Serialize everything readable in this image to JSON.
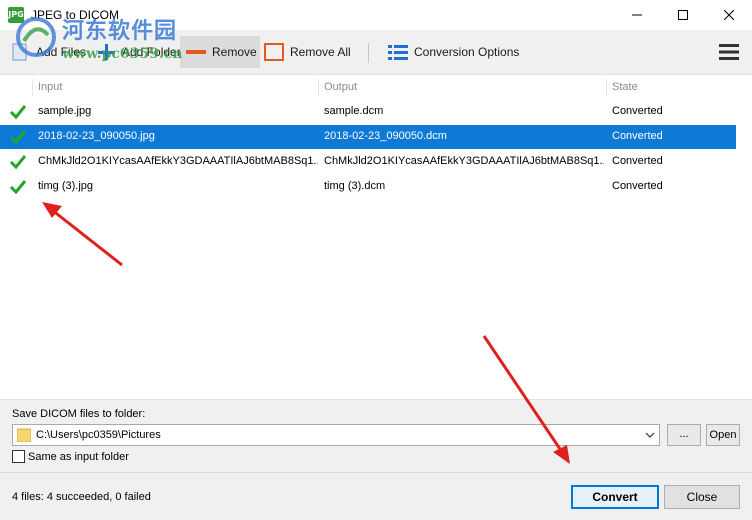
{
  "window": {
    "title": "JPEG to DICOM",
    "icon_label": "JPG"
  },
  "watermark": {
    "text_cn": "河东软件园",
    "text_url": "www.pc0359.cn"
  },
  "toolbar": {
    "add_files_label": "Add Files",
    "add_folder_label": "Add Folder",
    "remove_label": "Remove",
    "remove_all_label": "Remove All",
    "conversion_options_label": "Conversion Options"
  },
  "table": {
    "columns": [
      "Input",
      "Output",
      "State"
    ],
    "rows": [
      {
        "input": "sample.jpg",
        "output": "sample.dcm",
        "state": "Converted"
      },
      {
        "input": "2018-02-23_090050.jpg",
        "output": "2018-02-23_090050.dcm",
        "state": "Converted"
      },
      {
        "input": "ChMkJld2O1KIYcasAAfEkkY3GDAAATIlAJ6btMAB8Sq1...",
        "output": "ChMkJld2O1KIYcasAAfEkkY3GDAAATIlAJ6btMAB8Sq1...",
        "state": "Converted"
      },
      {
        "input": "timg (3).jpg",
        "output": "timg (3).dcm",
        "state": "Converted"
      }
    ]
  },
  "save": {
    "label": "Save DICOM files to folder:",
    "folder_path": "C:\\Users\\pc0359\\Pictures",
    "browse_label": "...",
    "open_label": "Open",
    "same_as_input_label": "Same as input folder"
  },
  "status": {
    "summary": "4 files: 4 succeeded, 0 failed",
    "convert_label": "Convert",
    "close_label": "Close"
  },
  "colors": {
    "selection": "#0f7ad6",
    "check_green": "#22a52a",
    "remove_orange": "#e25a1c",
    "accent_blue": "#1f6fd1",
    "arrow_red": "#e0201a"
  }
}
